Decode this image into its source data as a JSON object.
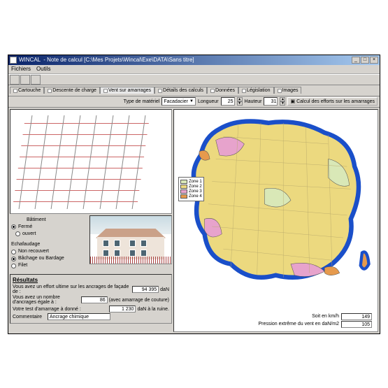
{
  "titlebar": {
    "app": "WINCAL",
    "doc": "Note de calcul [C:\\Mes Projets\\Wincal\\Exe\\DATA\\Sans titre]"
  },
  "menu": {
    "file": "Fichiers",
    "tools": "Outils"
  },
  "tabs": {
    "t1": "Cartouche",
    "t2": "Descente de charge",
    "t3": "Vent sur amarrages",
    "t4": "Détails des calculs",
    "t5": "Données",
    "t6": "Législation",
    "t7": "Images"
  },
  "params": {
    "type_label": "Type de matériel",
    "type_value": "Facadacier",
    "longueur_label": "Longueur",
    "longueur_value": "25",
    "hauteur_label": "Hauteur",
    "hauteur_value": "31",
    "calc_button": "Calcul des efforts sur les amarrages"
  },
  "options": {
    "batiment_label": "Bâtiment",
    "ferme": "Fermé",
    "ouvert": "ouvert",
    "echafaudage_label": "Echafaudage",
    "non_recouvert": "Non recouvert",
    "bachage": "Bâchage ou Bardage",
    "filet": "Filet"
  },
  "results": {
    "heading": "Résultats",
    "line1_label": "Vous avez un effort ultime sur les ancrages de façade de :",
    "line1_value": "94 395",
    "line1_unit": "daN",
    "line2_label": "Vous avez un nombre d'ancrages égale à :",
    "line2_value": "86",
    "line2_suffix": "(avec amarrage de couture)",
    "line3_label": "Votre test d'amarrage à donné :",
    "line3_value": "1 230",
    "line3_unit": "daN à la ruine.",
    "comment_label": "Commentaire",
    "comment_value": "Ancrage chimique"
  },
  "legend": {
    "z1": "Zone 1",
    "z2": "Zone 2",
    "z3": "Zone 3",
    "z4": "Zone 4",
    "c1": "#d9e8b7",
    "c2": "#ecd97f",
    "c3": "#e7a3cc",
    "c4": "#e69a4d"
  },
  "map_readout": {
    "kmh_label": "Soit en km/h",
    "kmh_value": "149",
    "pressure_label": "Pression extrême du vent en daN/m2",
    "pressure_value": "105"
  }
}
